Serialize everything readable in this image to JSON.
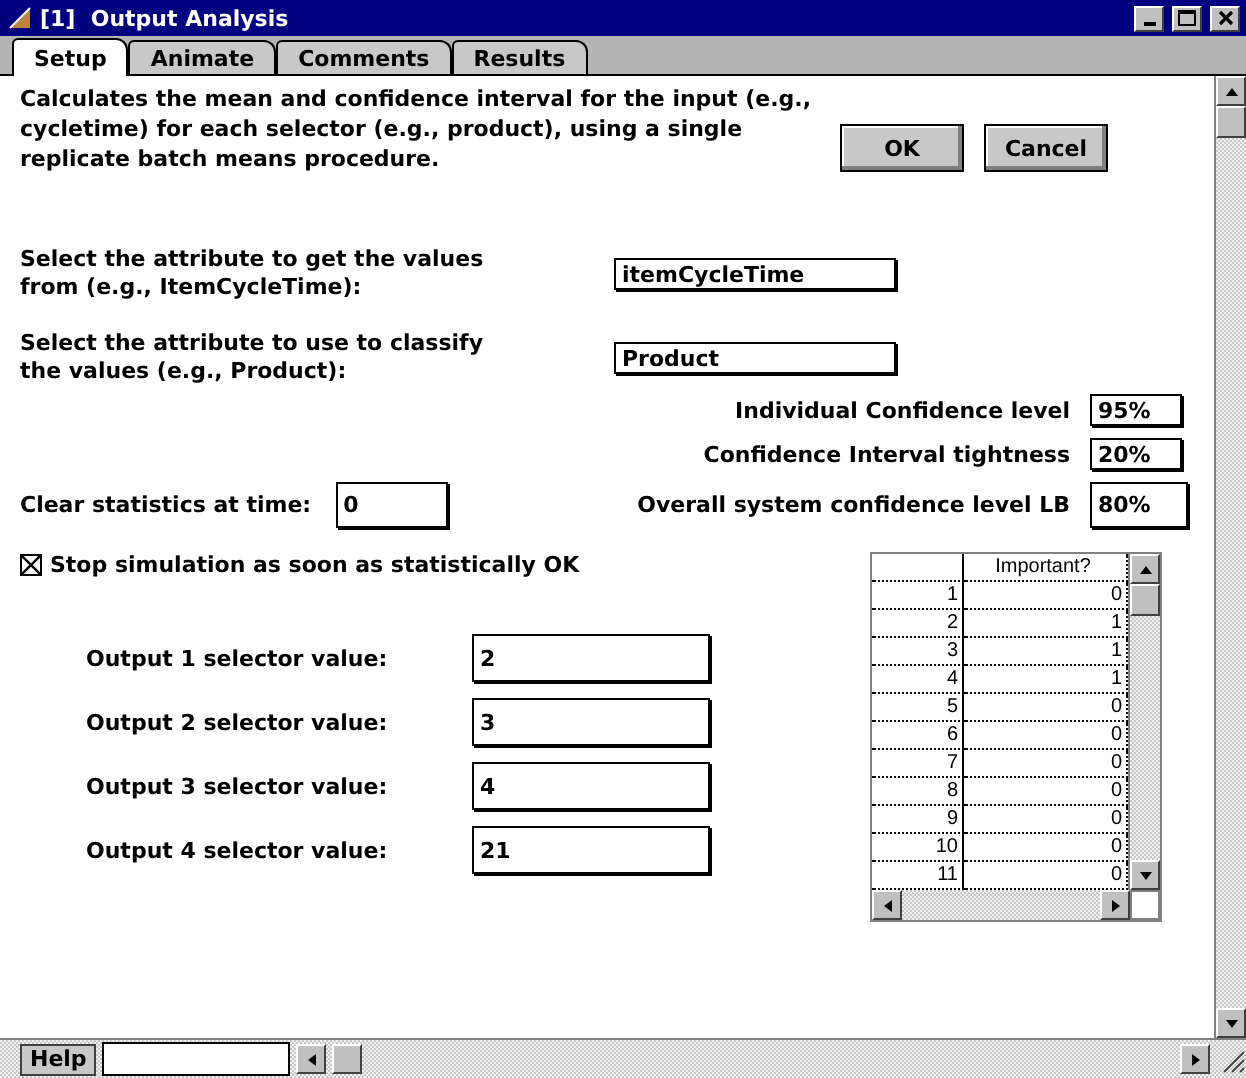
{
  "window": {
    "title": "[1]  Output Analysis"
  },
  "tabs": [
    {
      "label": "Setup",
      "selected": true
    },
    {
      "label": "Animate",
      "selected": false
    },
    {
      "label": "Comments",
      "selected": false
    },
    {
      "label": "Results",
      "selected": false
    }
  ],
  "description": "Calculates the mean and confidence interval for the input (e.g., cycletime) for each selector (e.g., product), using a single replicate batch means procedure.",
  "buttons": [
    "OK",
    "Cancel"
  ],
  "attribute_fields": [
    {
      "label": "Select the attribute to get the values from (e.g., ItemCycleTime):",
      "value": "itemCycleTime"
    },
    {
      "label": "Select the attribute to use to classify the values (e.g., Product):",
      "value": "Product"
    }
  ],
  "confidence_fields": [
    {
      "label": "Individual Confidence level",
      "value": "95%"
    },
    {
      "label": "Confidence Interval tightness",
      "value": "20%"
    },
    {
      "label": "Overall system confidence level LB",
      "value": "80%"
    }
  ],
  "clear_statistics": {
    "label": "Clear statistics at time:",
    "value": "0"
  },
  "stop_checkbox": {
    "label": "Stop simulation as soon as statistically OK",
    "checked": true
  },
  "outputs": [
    {
      "label": "Output 1 selector value:",
      "value": "2"
    },
    {
      "label": "Output 2 selector value:",
      "value": "3"
    },
    {
      "label": "Output 3 selector value:",
      "value": "4"
    },
    {
      "label": "Output 4 selector value:",
      "value": "21"
    }
  ],
  "table": {
    "column_header": "Important?",
    "rows": [
      {
        "index": "1",
        "value": "0"
      },
      {
        "index": "2",
        "value": "1"
      },
      {
        "index": "3",
        "value": "1"
      },
      {
        "index": "4",
        "value": "1"
      },
      {
        "index": "5",
        "value": "0"
      },
      {
        "index": "6",
        "value": "0"
      },
      {
        "index": "7",
        "value": "0"
      },
      {
        "index": "8",
        "value": "0"
      },
      {
        "index": "9",
        "value": "0"
      },
      {
        "index": "10",
        "value": "0"
      },
      {
        "index": "11",
        "value": "0"
      }
    ]
  },
  "status_bar": {
    "help_button": "Help"
  }
}
